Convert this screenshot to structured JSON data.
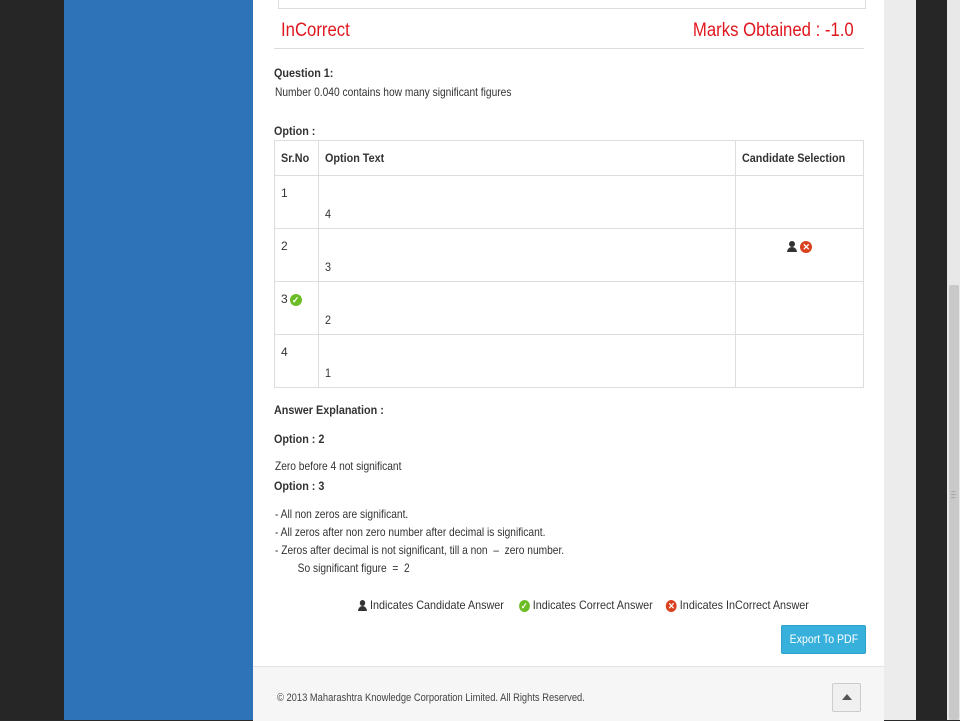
{
  "result": {
    "status": "InCorrect",
    "marks_label": "Marks Obtained :",
    "marks_value": "-1.0",
    "status_color": "#e0171f"
  },
  "question": {
    "title": "Question 1:",
    "text": "Number 0.040 contains how many significant figures"
  },
  "options_section": {
    "title": "Option :",
    "headers": [
      "Sr.No",
      "Option Text",
      "Candidate Selection"
    ],
    "rows": [
      {
        "sr": "1",
        "text": "4",
        "correct": false,
        "selected": false
      },
      {
        "sr": "2",
        "text": "3",
        "correct": false,
        "selected": true
      },
      {
        "sr": "3",
        "text": "2",
        "correct": true,
        "selected": false
      },
      {
        "sr": "4",
        "text": "1",
        "correct": false,
        "selected": false
      }
    ]
  },
  "explanation": {
    "title": "Answer Explanation :",
    "option2_title": "Option : 2",
    "option2_text": "Zero before 4 not significant",
    "option3_title": "Option : 3",
    "option3_lines": [
      "- All non zeros are significant.",
      "- All zeros after non zero number after decimal is significant.",
      "- Zeros after decimal is not significant, till a non  –  zero number.",
      "        So significant figure  =  2"
    ]
  },
  "legend": {
    "candidate": "Indicates Candidate Answer",
    "correct": "Indicates Correct Answer",
    "incorrect": "Indicates InCorrect Answer",
    "icons": [
      "user-icon",
      "check-circle-icon",
      "x-circle-icon"
    ]
  },
  "export_button": "Export To PDF",
  "footer": {
    "copyright": "© 2013 Maharashtra Knowledge Corporation Limited. All Rights Reserved."
  },
  "colors": {
    "sidebar_blue": "#2e73b8",
    "correct_green": "#6cbd25",
    "incorrect_red": "#d9411e",
    "button_blue": "#37b0dc"
  }
}
